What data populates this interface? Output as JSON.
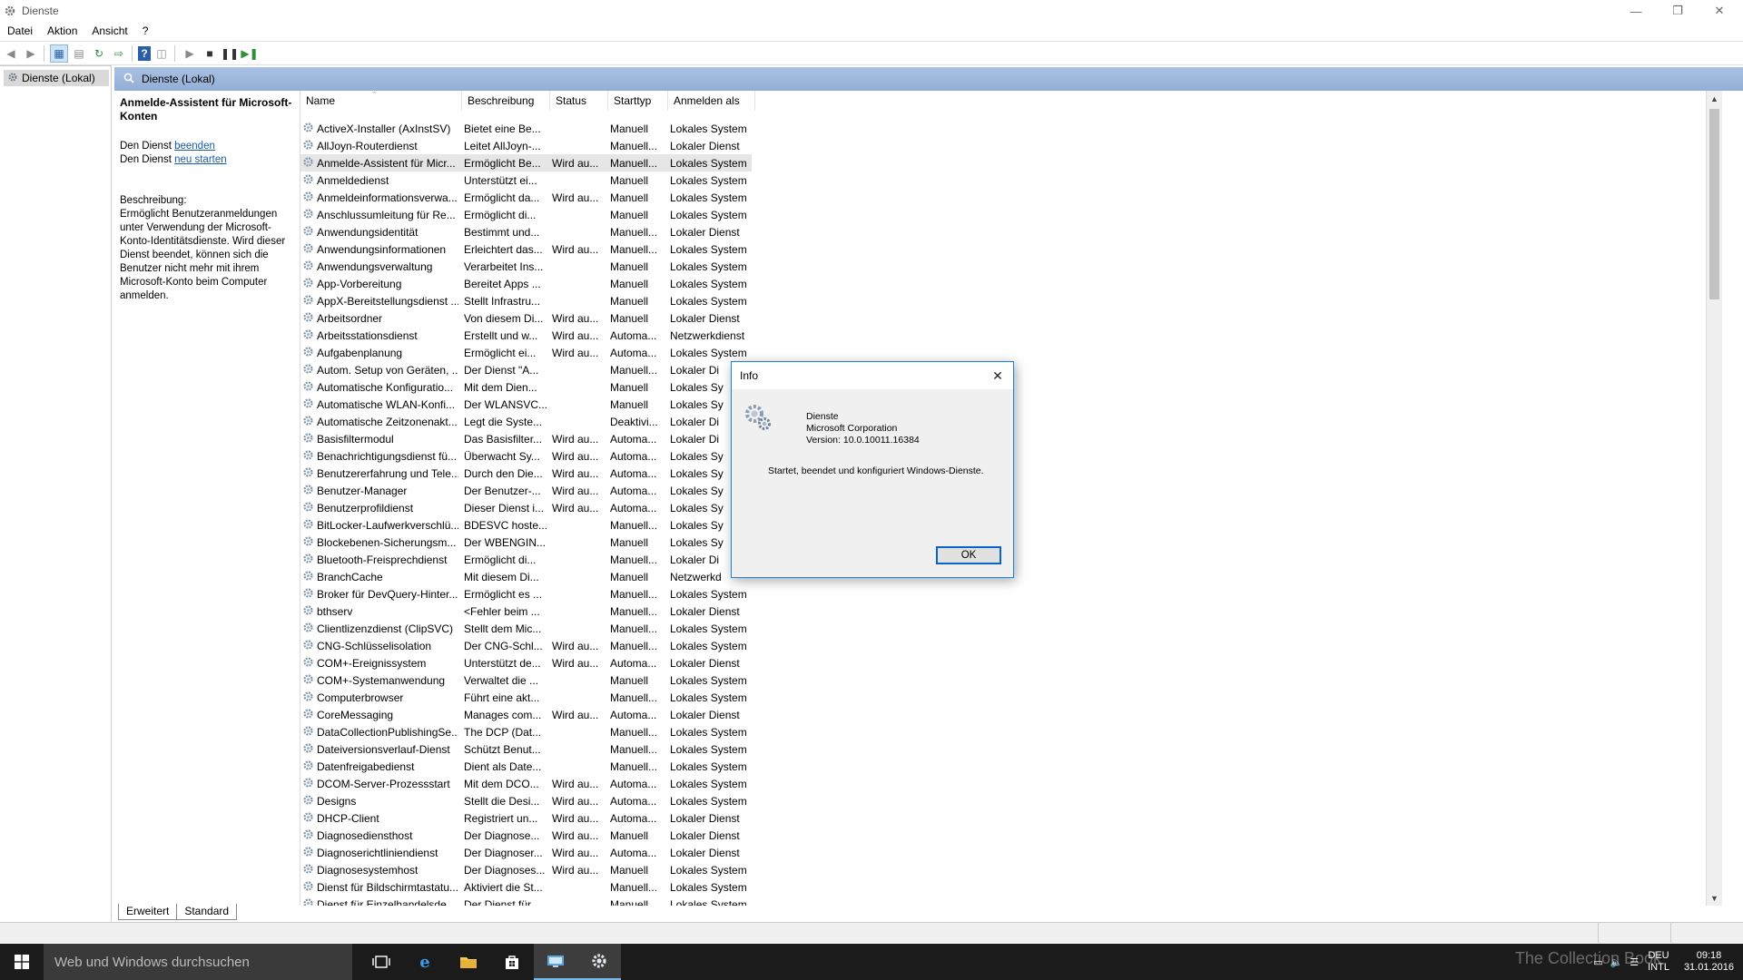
{
  "window": {
    "title": "Dienste"
  },
  "menu": [
    "Datei",
    "Aktion",
    "Ansicht",
    "?"
  ],
  "tree": {
    "root": "Dienste (Lokal)"
  },
  "header": {
    "title": "Dienste (Lokal)"
  },
  "detail": {
    "service_name": "Anmelde-Assistent für Microsoft-Konten",
    "stop_prefix": "Den Dienst ",
    "stop_link": "beenden",
    "restart_prefix": "Den Dienst ",
    "restart_link": "neu starten",
    "description_label": "Beschreibung:",
    "description": "Ermöglicht Benutzeranmeldungen unter Verwendung der Microsoft-Konto-Identitätsdienste. Wird dieser Dienst beendet, können sich die Benutzer nicht mehr mit ihrem Microsoft-Konto beim Computer anmelden."
  },
  "columns": {
    "name": "Name",
    "description": "Beschreibung",
    "status": "Status",
    "startup": "Starttyp",
    "logon": "Anmelden als"
  },
  "services": [
    {
      "name": "ActiveX-Installer (AxInstSV)",
      "desc": "Bietet eine Be...",
      "status": "",
      "start": "Manuell",
      "logon": "Lokales System"
    },
    {
      "name": "AllJoyn-Routerdienst",
      "desc": "Leitet AllJoyn-...",
      "status": "",
      "start": "Manuell...",
      "logon": "Lokaler Dienst"
    },
    {
      "name": "Anmelde-Assistent für Micr...",
      "desc": "Ermöglicht Be...",
      "status": "Wird au...",
      "start": "Manuell...",
      "logon": "Lokales System"
    },
    {
      "name": "Anmeldedienst",
      "desc": "Unterstützt ei...",
      "status": "",
      "start": "Manuell",
      "logon": "Lokales System"
    },
    {
      "name": "Anmeldeinformationsverwa...",
      "desc": "Ermöglicht da...",
      "status": "Wird au...",
      "start": "Manuell",
      "logon": "Lokales System"
    },
    {
      "name": "Anschlussumleitung für Re...",
      "desc": "Ermöglicht di...",
      "status": "",
      "start": "Manuell",
      "logon": "Lokales System"
    },
    {
      "name": "Anwendungsidentität",
      "desc": "Bestimmt und...",
      "status": "",
      "start": "Manuell...",
      "logon": "Lokaler Dienst"
    },
    {
      "name": "Anwendungsinformationen",
      "desc": "Erleichtert das...",
      "status": "Wird au...",
      "start": "Manuell...",
      "logon": "Lokales System"
    },
    {
      "name": "Anwendungsverwaltung",
      "desc": "Verarbeitet Ins...",
      "status": "",
      "start": "Manuell",
      "logon": "Lokales System"
    },
    {
      "name": "App-Vorbereitung",
      "desc": "Bereitet Apps ...",
      "status": "",
      "start": "Manuell",
      "logon": "Lokales System"
    },
    {
      "name": "AppX-Bereitstellungsdienst ...",
      "desc": "Stellt Infrastru...",
      "status": "",
      "start": "Manuell",
      "logon": "Lokales System"
    },
    {
      "name": "Arbeitsordner",
      "desc": "Von diesem Di...",
      "status": "Wird au...",
      "start": "Manuell",
      "logon": "Lokaler Dienst"
    },
    {
      "name": "Arbeitsstationsdienst",
      "desc": "Erstellt und w...",
      "status": "Wird au...",
      "start": "Automa...",
      "logon": "Netzwerkdienst"
    },
    {
      "name": "Aufgabenplanung",
      "desc": "Ermöglicht ei...",
      "status": "Wird au...",
      "start": "Automa...",
      "logon": "Lokales System"
    },
    {
      "name": "Autom. Setup von Geräten, ...",
      "desc": "Der Dienst \"A...",
      "status": "",
      "start": "Manuell...",
      "logon": "Lokaler Di"
    },
    {
      "name": "Automatische Konfiguratio...",
      "desc": "Mit dem Dien...",
      "status": "",
      "start": "Manuell",
      "logon": "Lokales Sy"
    },
    {
      "name": "Automatische WLAN-Konfi...",
      "desc": "Der WLANSVC...",
      "status": "",
      "start": "Manuell",
      "logon": "Lokales Sy"
    },
    {
      "name": "Automatische Zeitzonenakt...",
      "desc": "Legt die Syste...",
      "status": "",
      "start": "Deaktivi...",
      "logon": "Lokaler Di"
    },
    {
      "name": "Basisfiltermodul",
      "desc": "Das Basisfilter...",
      "status": "Wird au...",
      "start": "Automa...",
      "logon": "Lokaler Di"
    },
    {
      "name": "Benachrichtigungsdienst fü...",
      "desc": "Überwacht Sy...",
      "status": "Wird au...",
      "start": "Automa...",
      "logon": "Lokales Sy"
    },
    {
      "name": "Benutzererfahrung und Tele...",
      "desc": "Durch den Die...",
      "status": "Wird au...",
      "start": "Automa...",
      "logon": "Lokales Sy"
    },
    {
      "name": "Benutzer-Manager",
      "desc": "Der Benutzer-...",
      "status": "Wird au...",
      "start": "Automa...",
      "logon": "Lokales Sy"
    },
    {
      "name": "Benutzerprofildienst",
      "desc": "Dieser Dienst i...",
      "status": "Wird au...",
      "start": "Automa...",
      "logon": "Lokales Sy"
    },
    {
      "name": "BitLocker-Laufwerkverschlü...",
      "desc": "BDESVC hoste...",
      "status": "",
      "start": "Manuell...",
      "logon": "Lokales Sy"
    },
    {
      "name": "Blockebenen-Sicherungsm...",
      "desc": "Der WBENGIN...",
      "status": "",
      "start": "Manuell",
      "logon": "Lokales Sy"
    },
    {
      "name": "Bluetooth-Freisprechdienst",
      "desc": "Ermöglicht di...",
      "status": "",
      "start": "Manuell...",
      "logon": "Lokaler Di"
    },
    {
      "name": "BranchCache",
      "desc": "Mit diesem Di...",
      "status": "",
      "start": "Manuell",
      "logon": "Netzwerkd"
    },
    {
      "name": "Broker für DevQuery-Hinter...",
      "desc": "Ermöglicht es ...",
      "status": "",
      "start": "Manuell...",
      "logon": "Lokales System"
    },
    {
      "name": "bthserv",
      "desc": "<Fehler beim ...",
      "status": "",
      "start": "Manuell...",
      "logon": "Lokaler Dienst"
    },
    {
      "name": "Clientlizenzdienst (ClipSVC)",
      "desc": "Stellt dem Mic...",
      "status": "",
      "start": "Manuell...",
      "logon": "Lokales System"
    },
    {
      "name": "CNG-Schlüsselisolation",
      "desc": "Der CNG-Schl...",
      "status": "Wird au...",
      "start": "Manuell...",
      "logon": "Lokales System"
    },
    {
      "name": "COM+-Ereignissystem",
      "desc": "Unterstützt de...",
      "status": "Wird au...",
      "start": "Automa...",
      "logon": "Lokaler Dienst"
    },
    {
      "name": "COM+-Systemanwendung",
      "desc": "Verwaltet die ...",
      "status": "",
      "start": "Manuell",
      "logon": "Lokales System"
    },
    {
      "name": "Computerbrowser",
      "desc": "Führt eine akt...",
      "status": "",
      "start": "Manuell...",
      "logon": "Lokales System"
    },
    {
      "name": "CoreMessaging",
      "desc": "Manages com...",
      "status": "Wird au...",
      "start": "Automa...",
      "logon": "Lokaler Dienst"
    },
    {
      "name": "DataCollectionPublishingSe...",
      "desc": "The DCP (Dat...",
      "status": "",
      "start": "Manuell...",
      "logon": "Lokales System"
    },
    {
      "name": "Dateiversionsverlauf-Dienst",
      "desc": "Schützt Benut...",
      "status": "",
      "start": "Manuell...",
      "logon": "Lokales System"
    },
    {
      "name": "Datenfreigabedienst",
      "desc": "Dient als Date...",
      "status": "",
      "start": "Manuell...",
      "logon": "Lokales System"
    },
    {
      "name": "DCOM-Server-Prozessstart",
      "desc": "Mit dem DCO...",
      "status": "Wird au...",
      "start": "Automa...",
      "logon": "Lokales System"
    },
    {
      "name": "Designs",
      "desc": "Stellt die Desi...",
      "status": "Wird au...",
      "start": "Automa...",
      "logon": "Lokales System"
    },
    {
      "name": "DHCP-Client",
      "desc": "Registriert un...",
      "status": "Wird au...",
      "start": "Automa...",
      "logon": "Lokaler Dienst"
    },
    {
      "name": "Diagnosediensthost",
      "desc": "Der Diagnose...",
      "status": "Wird au...",
      "start": "Manuell",
      "logon": "Lokaler Dienst"
    },
    {
      "name": "Diagnoserichtliniendienst",
      "desc": "Der Diagnoser...",
      "status": "Wird au...",
      "start": "Automa...",
      "logon": "Lokaler Dienst"
    },
    {
      "name": "Diagnosesystemhost",
      "desc": "Der Diagnoses...",
      "status": "Wird au...",
      "start": "Manuell",
      "logon": "Lokales System"
    },
    {
      "name": "Dienst für Bildschirmtastatu...",
      "desc": "Aktiviert die St...",
      "status": "",
      "start": "Manuell...",
      "logon": "Lokales System"
    },
    {
      "name": "Dienst für Einzelhandelsde...",
      "desc": "Der Dienst für ...",
      "status": "",
      "start": "Manuell...",
      "logon": "Lokales System"
    }
  ],
  "tabs": [
    "Erweitert",
    "Standard"
  ],
  "dialog": {
    "title": "Info",
    "app_name": "Dienste",
    "company": "Microsoft Corporation",
    "version": "Version: 10.0.10011.16384",
    "description": "Startet, beendet und konfiguriert Windows-Dienste.",
    "ok_label": "OK"
  },
  "taskbar": {
    "search_placeholder": "Web und Windows durchsuchen",
    "lang_top": "DEU",
    "lang_bottom": "INTL",
    "time": "09:18",
    "date": "31.01.2016",
    "watermark": "The Collection Book"
  },
  "colors": {
    "header_blue": "#99b4d9",
    "accent": "#1883d7",
    "taskbar": "#1b1b1b"
  }
}
